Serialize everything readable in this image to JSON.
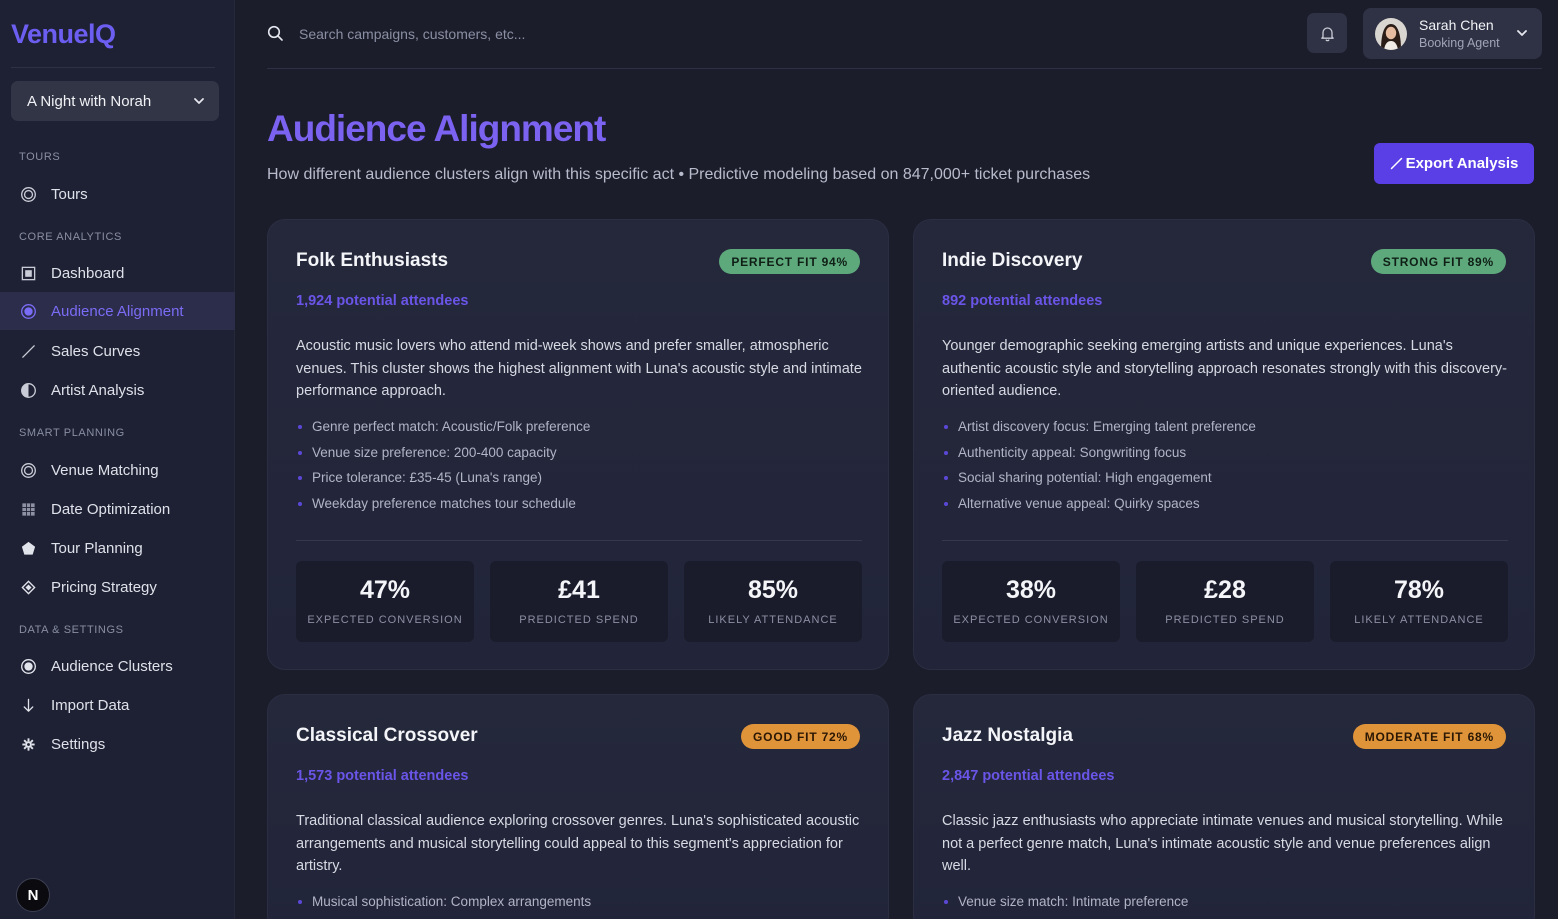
{
  "app": {
    "logo": "VenuelQ"
  },
  "sidebar": {
    "tour_select": "A Night with Norah",
    "sections": {
      "tours": "TOURS",
      "core": "CORE ANALYTICS",
      "smart": "SMART PLANNING",
      "data": "DATA & SETTINGS"
    },
    "items": {
      "tours": "Tours",
      "dashboard": "Dashboard",
      "audience_alignment": "Audience Alignment",
      "sales_curves": "Sales Curves",
      "artist_analysis": "Artist Analysis",
      "venue_matching": "Venue Matching",
      "date_optimization": "Date Optimization",
      "tour_planning": "Tour Planning",
      "pricing_strategy": "Pricing Strategy",
      "audience_clusters": "Audience Clusters",
      "import_data": "Import Data",
      "settings": "Settings"
    },
    "active": "audience_alignment",
    "footer_avatar": "N"
  },
  "header": {
    "search_placeholder": "Search campaigns, customers, etc...",
    "user": {
      "name": "Sarah Chen",
      "role": "Booking Agent"
    }
  },
  "page": {
    "title": "Audience Alignment",
    "subtitle": "How different audience clusters align with this specific act • Predictive modeling based on 847,000+ ticket purchases",
    "export_label": "Export Analysis"
  },
  "colors": {
    "accent": "#5b3fe6",
    "title": "#7b62f0",
    "badge_green": "#5da97c",
    "badge_orange": "#e0943a"
  },
  "clusters": [
    {
      "name": "Folk Enthusiasts",
      "badge": "PERFECT FIT 94%",
      "badge_color": "green",
      "attendees": "1,924 potential attendees",
      "description": "Acoustic music lovers who attend mid-week shows and prefer smaller, atmospheric venues. This cluster shows the highest alignment with Luna's acoustic style and intimate performance approach.",
      "bullets": [
        "Genre perfect match: Acoustic/Folk preference",
        "Venue size preference: 200-400 capacity",
        "Price tolerance: £35-45 (Luna's range)",
        "Weekday preference matches tour schedule"
      ],
      "stats": [
        {
          "value": "47%",
          "label": "EXPECTED CONVERSION"
        },
        {
          "value": "£41",
          "label": "PREDICTED SPEND"
        },
        {
          "value": "85%",
          "label": "LIKELY ATTENDANCE"
        }
      ]
    },
    {
      "name": "Indie Discovery",
      "badge": "STRONG FIT 89%",
      "badge_color": "green",
      "attendees": "892 potential attendees",
      "description": "Younger demographic seeking emerging artists and unique experiences. Luna's authentic acoustic style and storytelling approach resonates strongly with this discovery-oriented audience.",
      "bullets": [
        "Artist discovery focus: Emerging talent preference",
        "Authenticity appeal: Songwriting focus",
        "Social sharing potential: High engagement",
        "Alternative venue appeal: Quirky spaces"
      ],
      "stats": [
        {
          "value": "38%",
          "label": "EXPECTED CONVERSION"
        },
        {
          "value": "£28",
          "label": "PREDICTED SPEND"
        },
        {
          "value": "78%",
          "label": "LIKELY ATTENDANCE"
        }
      ]
    },
    {
      "name": "Classical Crossover",
      "badge": "GOOD FIT 72%",
      "badge_color": "orange",
      "attendees": "1,573 potential attendees",
      "description": "Traditional classical audience exploring crossover genres. Luna's sophisticated acoustic arrangements and musical storytelling could appeal to this segment's appreciation for artistry.",
      "bullets": [
        "Musical sophistication: Complex arrangements"
      ]
    },
    {
      "name": "Jazz Nostalgia",
      "badge": "MODERATE FIT 68%",
      "badge_color": "orange",
      "attendees": "2,847 potential attendees",
      "description": "Classic jazz enthusiasts who appreciate intimate venues and musical storytelling. While not a perfect genre match, Luna's intimate acoustic style and venue preferences align well.",
      "bullets": [
        "Venue size match: Intimate preference"
      ]
    }
  ]
}
